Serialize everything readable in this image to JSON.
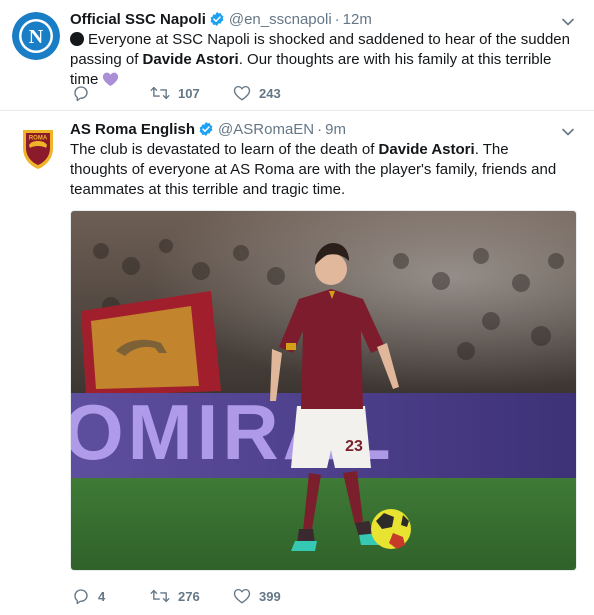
{
  "tweets": [
    {
      "name": "Official SSC Napoli",
      "handle": "@en_sscnapoli",
      "separator": "·",
      "time": "12m",
      "text_parts": [
        "Everyone at SSC Napoli is shocked and saddened to hear of the sudden passing of ",
        "Davide Astori",
        ". Our thoughts are with his family at this terrible time"
      ],
      "avatar_label": "N",
      "actions": {
        "reply": "",
        "retweet": "107",
        "like": "243"
      },
      "icons": [
        "black-circle-icon",
        "purple-heart-icon",
        "verified-icon",
        "caret-down-icon",
        "reply-icon",
        "retweet-icon",
        "like-icon"
      ]
    },
    {
      "name": "AS Roma English",
      "handle": "@ASRomaEN",
      "separator": "·",
      "time": "9m",
      "text_parts": [
        "The club is devastated to learn of the death of ",
        "Davide Astori",
        ". The thoughts of everyone at AS Roma are with the player's family, friends and teammates at this terrible and tragic time."
      ],
      "avatar_label": "ROMA",
      "photo_banner_text": "OMIRAL",
      "photo_jersey_number": "23",
      "actions": {
        "reply": "4",
        "retweet": "276",
        "like": "399"
      },
      "icons": [
        "roma-crest-icon",
        "verified-icon",
        "caret-down-icon",
        "reply-icon",
        "retweet-icon",
        "like-icon"
      ]
    }
  ],
  "colors": {
    "verified_blue": "#1da1f2",
    "secondary_text": "#657786",
    "primary_text": "#14171a",
    "napoli_blue": "#1a7ec7",
    "roma_maroon": "#8b1a2b",
    "roma_gold": "#f0b429",
    "purple_heart": "#aa8ed6"
  }
}
